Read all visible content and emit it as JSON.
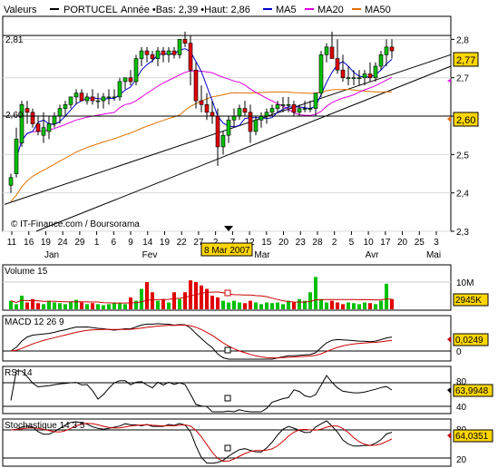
{
  "header": {
    "label": "Valeurs",
    "symbol": "PORTUCEL",
    "range_text": "Année •Bas: 2,39 •Haut: 2,86",
    "ma5_label": "MA5",
    "ma20_label": "MA20",
    "ma50_label": "MA50",
    "ma5_color": "#0000cc",
    "ma20_color": "#e000e0",
    "ma50_color": "#e07000"
  },
  "main_chart": {
    "credit": "© IT-Finance.com / Boursorama",
    "date_marker": "8 Mar 2007",
    "left_high_label": "2,81",
    "left_low_label": "2,60",
    "ymin": 2.3,
    "ymax": 2.86,
    "y_ticks": [
      {
        "v": 2.3,
        "label": "2,3"
      },
      {
        "v": 2.4,
        "label": "2,4"
      },
      {
        "v": 2.5,
        "label": "2,5"
      },
      {
        "v": 2.6,
        "label": "2,6"
      },
      {
        "v": 2.7,
        "label": "2,7"
      },
      {
        "v": 2.8,
        "label": "2,8"
      }
    ],
    "ref_levels": [
      2.81,
      2.6
    ],
    "last_badge": "2,77",
    "low_badge": "2,60",
    "day_labels": [
      "11",
      "16",
      "19",
      "24",
      "29",
      "1",
      "6",
      "9",
      "14",
      "19",
      "22",
      "27",
      "2",
      "7",
      "12",
      "15",
      "20",
      "23",
      "28",
      "2",
      "5",
      "10",
      "17",
      "20",
      "25",
      "3"
    ],
    "month_labels": [
      "Jan",
      "Fev",
      "Mar",
      "Avr",
      "Mai"
    ]
  },
  "chart_data": [
    {
      "type": "candlestick",
      "title": "PORTUCEL",
      "x": [
        "01-11",
        "01-12",
        "01-15",
        "01-16",
        "01-17",
        "01-18",
        "01-19",
        "01-22",
        "01-23",
        "01-24",
        "01-25",
        "01-26",
        "01-29",
        "01-30",
        "01-31",
        "02-01",
        "02-02",
        "02-05",
        "02-06",
        "02-07",
        "02-08",
        "02-09",
        "02-12",
        "02-13",
        "02-14",
        "02-15",
        "02-16",
        "02-19",
        "02-20",
        "02-21",
        "02-22",
        "02-23",
        "02-26",
        "02-27",
        "02-28",
        "03-01",
        "03-02",
        "03-05",
        "03-06",
        "03-07",
        "03-08",
        "03-09",
        "03-12",
        "03-13",
        "03-14",
        "03-15",
        "03-16",
        "03-19",
        "03-20",
        "03-21",
        "03-22",
        "03-23",
        "03-26",
        "03-27",
        "03-28",
        "03-29",
        "03-30",
        "04-02",
        "04-03",
        "04-04",
        "04-05",
        "04-10",
        "04-11",
        "04-12",
        "04-13",
        "04-16",
        "04-17",
        "04-18",
        "04-19",
        "04-20",
        "04-23"
      ],
      "series": [
        {
          "name": "OHLC",
          "open": [
            2.42,
            2.45,
            2.53,
            2.62,
            2.61,
            2.58,
            2.55,
            2.56,
            2.58,
            2.6,
            2.62,
            2.63,
            2.65,
            2.66,
            2.64,
            2.65,
            2.64,
            2.64,
            2.65,
            2.65,
            2.65,
            2.69,
            2.7,
            2.69,
            2.75,
            2.77,
            2.76,
            2.75,
            2.77,
            2.76,
            2.77,
            2.76,
            2.8,
            2.79,
            2.72,
            2.64,
            2.63,
            2.61,
            2.6,
            2.52,
            2.55,
            2.59,
            2.6,
            2.62,
            2.61,
            2.56,
            2.59,
            2.6,
            2.61,
            2.62,
            2.63,
            2.63,
            2.63,
            2.61,
            2.62,
            2.62,
            2.62,
            2.66,
            2.76,
            2.78,
            2.75,
            2.72,
            2.7,
            2.7,
            2.7,
            2.7,
            2.71,
            2.7,
            2.73,
            2.76,
            2.78
          ],
          "high": [
            2.45,
            2.57,
            2.64,
            2.64,
            2.62,
            2.6,
            2.61,
            2.6,
            2.61,
            2.63,
            2.64,
            2.65,
            2.67,
            2.67,
            2.66,
            2.67,
            2.66,
            2.66,
            2.67,
            2.67,
            2.7,
            2.7,
            2.72,
            2.76,
            2.78,
            2.78,
            2.77,
            2.78,
            2.78,
            2.78,
            2.78,
            2.8,
            2.82,
            2.81,
            2.74,
            2.68,
            2.66,
            2.64,
            2.62,
            2.56,
            2.6,
            2.62,
            2.63,
            2.64,
            2.63,
            2.6,
            2.61,
            2.62,
            2.63,
            2.64,
            2.65,
            2.65,
            2.64,
            2.63,
            2.64,
            2.64,
            2.65,
            2.77,
            2.79,
            2.82,
            2.8,
            2.76,
            2.73,
            2.72,
            2.72,
            2.72,
            2.74,
            2.74,
            2.77,
            2.8,
            2.8
          ],
          "low": [
            2.4,
            2.44,
            2.52,
            2.58,
            2.57,
            2.55,
            2.53,
            2.54,
            2.57,
            2.58,
            2.6,
            2.62,
            2.63,
            2.64,
            2.63,
            2.63,
            2.62,
            2.62,
            2.63,
            2.64,
            2.64,
            2.67,
            2.68,
            2.68,
            2.73,
            2.74,
            2.74,
            2.73,
            2.74,
            2.74,
            2.75,
            2.75,
            2.78,
            2.68,
            2.62,
            2.61,
            2.59,
            2.58,
            2.47,
            2.5,
            2.53,
            2.57,
            2.59,
            2.6,
            2.53,
            2.55,
            2.57,
            2.58,
            2.6,
            2.61,
            2.61,
            2.61,
            2.6,
            2.6,
            2.61,
            2.61,
            2.6,
            2.65,
            2.74,
            2.75,
            2.71,
            2.69,
            2.68,
            2.68,
            2.68,
            2.68,
            2.69,
            2.69,
            2.72,
            2.73,
            2.75
          ],
          "close": [
            2.44,
            2.54,
            2.63,
            2.61,
            2.58,
            2.56,
            2.57,
            2.58,
            2.6,
            2.62,
            2.63,
            2.65,
            2.66,
            2.64,
            2.65,
            2.64,
            2.64,
            2.65,
            2.65,
            2.65,
            2.69,
            2.7,
            2.69,
            2.75,
            2.77,
            2.76,
            2.75,
            2.77,
            2.76,
            2.77,
            2.76,
            2.8,
            2.79,
            2.72,
            2.64,
            2.63,
            2.61,
            2.6,
            2.52,
            2.55,
            2.59,
            2.6,
            2.62,
            2.61,
            2.56,
            2.59,
            2.6,
            2.61,
            2.62,
            2.63,
            2.63,
            2.63,
            2.61,
            2.62,
            2.62,
            2.62,
            2.66,
            2.76,
            2.78,
            2.75,
            2.72,
            2.7,
            2.7,
            2.7,
            2.7,
            2.71,
            2.7,
            2.73,
            2.76,
            2.78,
            2.77
          ]
        }
      ],
      "ylim": [
        2.3,
        2.86
      ]
    },
    {
      "type": "bar",
      "title": "Volume 15",
      "last_value": "2945K",
      "y_tick_label": "10M",
      "values_k": [
        2500,
        1500,
        4000,
        2000,
        3000,
        1800,
        1500,
        2500,
        2000,
        1800,
        1500,
        2200,
        2800,
        2000,
        1500,
        1800,
        1500,
        1200,
        1500,
        2000,
        1800,
        1500,
        3500,
        2500,
        6000,
        8000,
        5000,
        2500,
        3000,
        2000,
        5000,
        3000,
        5000,
        8500,
        8000,
        7000,
        6000,
        4000,
        3500,
        2500,
        2000,
        2500,
        2000,
        1800,
        2500,
        2000,
        1500,
        2000,
        1800,
        2000,
        1500,
        2500,
        2000,
        3000,
        2500,
        5000,
        9500,
        3000,
        2000,
        2500,
        2000,
        1500,
        2000,
        1800,
        1500,
        2000,
        1800,
        1500,
        2500,
        7500,
        3000
      ],
      "ylim": [
        0,
        12000
      ]
    },
    {
      "type": "line",
      "title": "MACD 12 26 9",
      "last_value": "0,0249",
      "y_tick_label": "0",
      "ylim": [
        -0.06,
        0.07
      ]
    },
    {
      "type": "line",
      "title": "RSI 14",
      "last_value": "63,9948",
      "y_tick_labels": [
        "80",
        "40"
      ],
      "ylim": [
        20,
        100
      ]
    },
    {
      "type": "line",
      "title": "Stochastique 14 3 5",
      "last_value": "64,0351",
      "y_tick_labels": [
        "80",
        "20"
      ],
      "ylim": [
        0,
        100
      ]
    }
  ]
}
